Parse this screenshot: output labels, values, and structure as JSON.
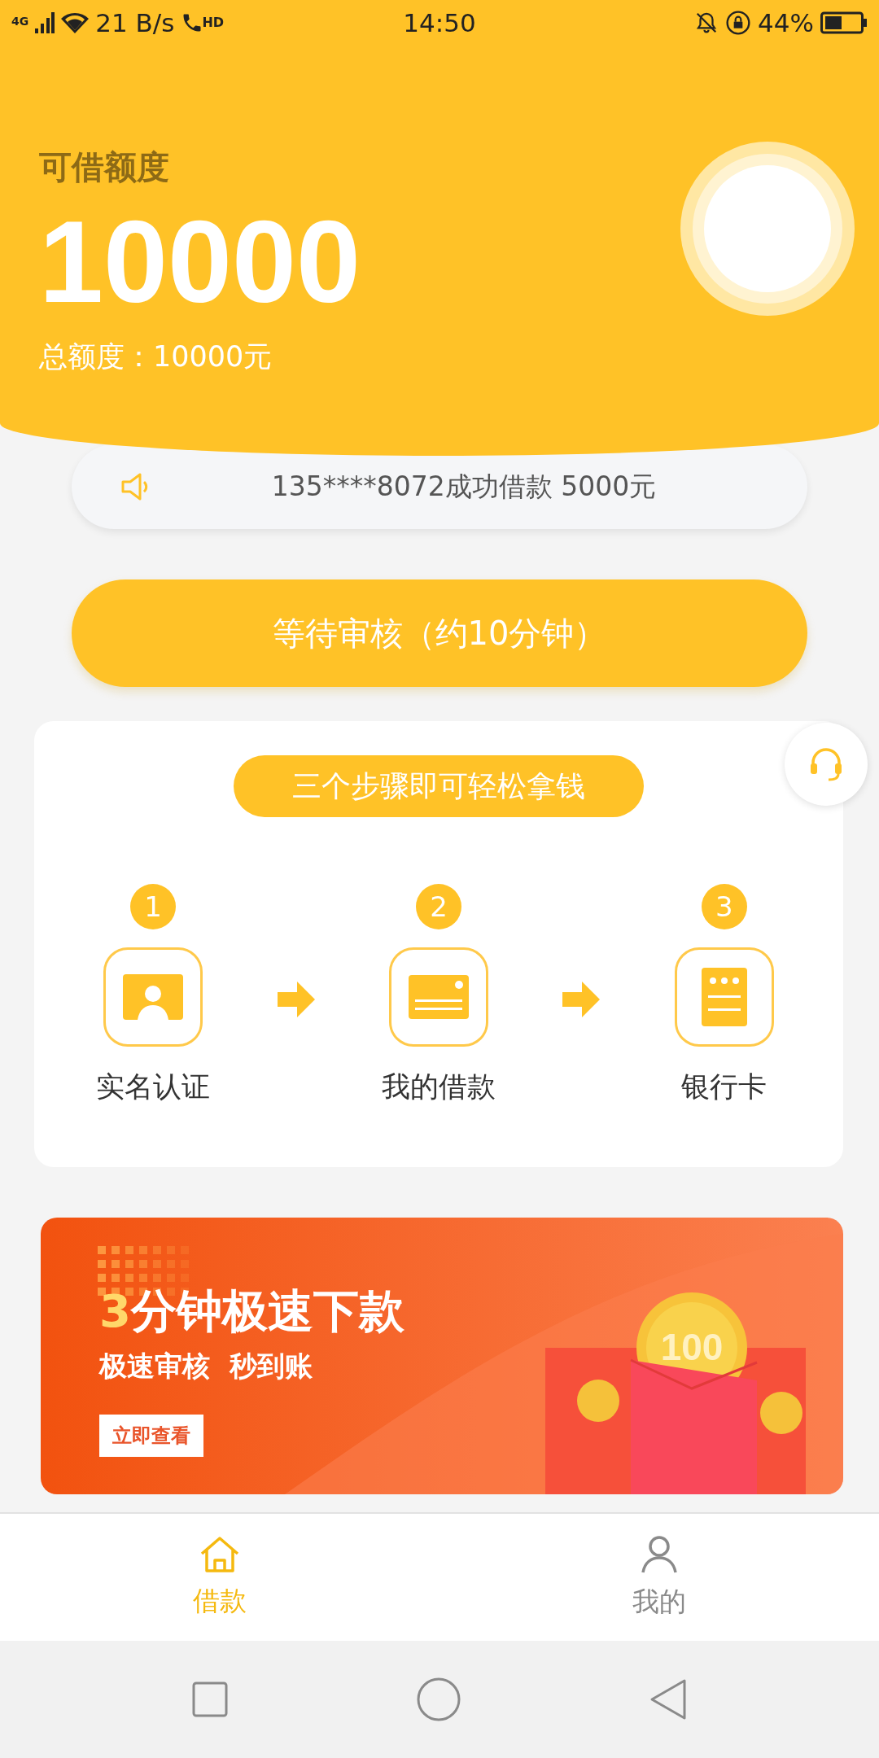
{
  "status_bar": {
    "network": "4G",
    "speed": "21 B/s",
    "call_badge": "HD",
    "time": "14:50",
    "battery": "44%"
  },
  "header": {
    "label": "可借额度",
    "amount": "10000",
    "total": "总额度：10000元"
  },
  "notice": {
    "text": "135****8072成功借款 5000元"
  },
  "action_button": {
    "label": "等待审核（约10分钟）"
  },
  "steps_card": {
    "title": "三个步骤即可轻松拿钱",
    "steps": [
      {
        "number": "1",
        "label": "实名认证",
        "kind": "id"
      },
      {
        "number": "2",
        "label": "我的借款",
        "kind": "card"
      },
      {
        "number": "3",
        "label": "银行卡",
        "kind": "bank"
      }
    ]
  },
  "promo_banner": {
    "headline_number": "3",
    "headline_text": "分钟极速下款",
    "subline": "极速审核  秒到账",
    "button": "立即查看",
    "coin_label": "100"
  },
  "bottom_nav": {
    "items": [
      {
        "label": "借款",
        "kind": "home",
        "selected": true
      },
      {
        "label": "我的",
        "kind": "profile",
        "selected": false
      }
    ]
  }
}
